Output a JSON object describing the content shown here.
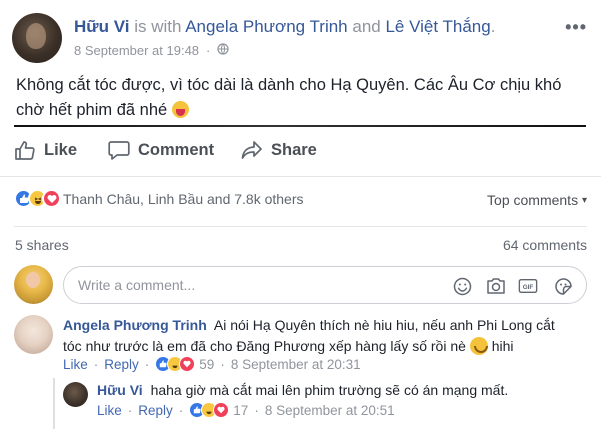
{
  "post": {
    "author": "Hữu Vi",
    "with_text": "is with",
    "tagged_1": "Angela Phương Trinh",
    "and_text": "and",
    "tagged_2": "Lê Việt Thắng",
    "period": ".",
    "timestamp": "8 September at 19:48",
    "privacy_separator": "·",
    "privacy_icon": "globe-icon",
    "more_label": "•••",
    "text": "Không cắt tóc được, vì tóc dài là dành cho Hạ Quyên. Các Âu Cơ chịu khó chờ hết phim đã nhé",
    "text_emoji": "tongue-emoji"
  },
  "actions": {
    "like": "Like",
    "comment": "Comment",
    "share": "Share"
  },
  "reactions": {
    "icons": [
      "like-reaction",
      "haha-reaction",
      "love-reaction"
    ],
    "summary": "Thanh Châu, Linh Bầu and 7.8k others",
    "top_comments": "Top comments",
    "top_comments_caret": "▾"
  },
  "stats": {
    "shares": "5 shares",
    "comments": "64 comments"
  },
  "composer": {
    "placeholder": "Write a comment...",
    "tools": [
      "emoji-icon",
      "camera-icon",
      "gif-icon",
      "sticker-icon"
    ]
  },
  "comments": [
    {
      "author": "Angela Phương Trinh",
      "text": "Ai nói Hạ Quyên thích nè hiu hiu, nếu anh Phi Long cắt tóc như trước là em đã cho Đăng Phương xếp hàng lấy số rồi nè",
      "text_tail": "hihi",
      "like": "Like",
      "reply": "Reply",
      "reaction_count": "59",
      "timestamp": "8 September at 20:31"
    },
    {
      "author": "Hữu Vi",
      "text": "haha giờ mà cắt mai lên phim trường sẽ có án mạng mất.",
      "like": "Like",
      "reply": "Reply",
      "reaction_count": "17",
      "timestamp": "8 September at 20:51"
    }
  ],
  "meta_sep": "·",
  "colors": {
    "link": "#365899",
    "muted": "#90949c",
    "like_blue": "#3578e5",
    "love_red": "#f0405a",
    "haha_yellow": "#f7c83f"
  }
}
